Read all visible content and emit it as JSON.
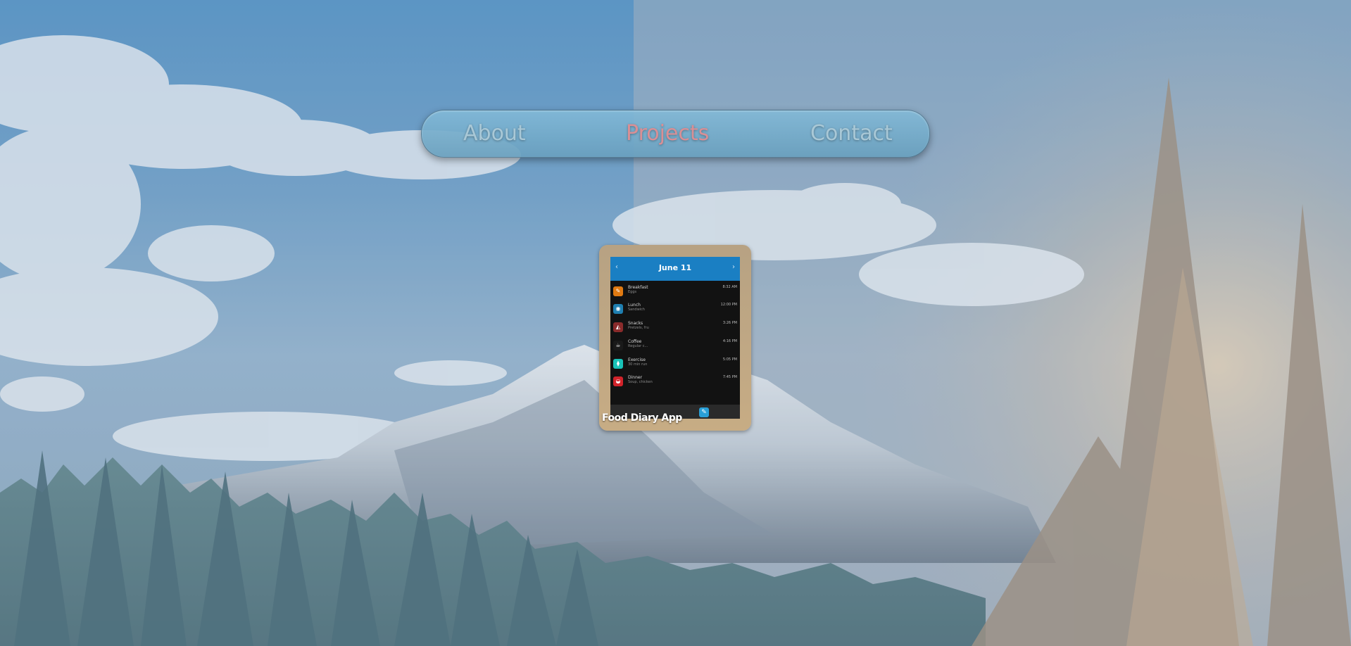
{
  "nav": {
    "about": "About",
    "projects": "Projects",
    "contact": "Contact"
  },
  "project_card": {
    "title": "Food Diary App",
    "screenshot": {
      "date": "June 11",
      "prev_icon": "chevron-left-icon",
      "next_icon": "chevron-right-icon",
      "entries": [
        {
          "title": "Breakfast",
          "detail": "Eggs",
          "time": "8:32 AM",
          "icon": "pencil-icon",
          "color": "#e07a12"
        },
        {
          "title": "Lunch",
          "detail": "Sandwich",
          "time": "12:00 PM",
          "icon": "bowl-icon",
          "color": "#1f7fb0"
        },
        {
          "title": "Snacks",
          "detail": "Pretzels, fru",
          "time": "3:26 PM",
          "icon": "pizza-icon",
          "color": "#8a2b2b"
        },
        {
          "title": "Coffee",
          "detail": "Regular c...",
          "time": "4:16 PM",
          "icon": "coffee-icon",
          "color": "#1a1a1a"
        },
        {
          "title": "Exercise",
          "detail": "30 min run",
          "time": "5:05 PM",
          "icon": "dumbbell-icon",
          "color": "#19c2b8"
        },
        {
          "title": "Dinner",
          "detail": "Soup, chicken",
          "time": "7:45 PM",
          "icon": "dinner-icon",
          "color": "#d2232a"
        }
      ],
      "fab_icon": "edit-icon"
    }
  },
  "colors": {
    "nav_active": "#d98f95",
    "nav_inactive": "#a9c8d6",
    "card_bg": "#c7ac84",
    "app_header": "#1a7fc3"
  }
}
